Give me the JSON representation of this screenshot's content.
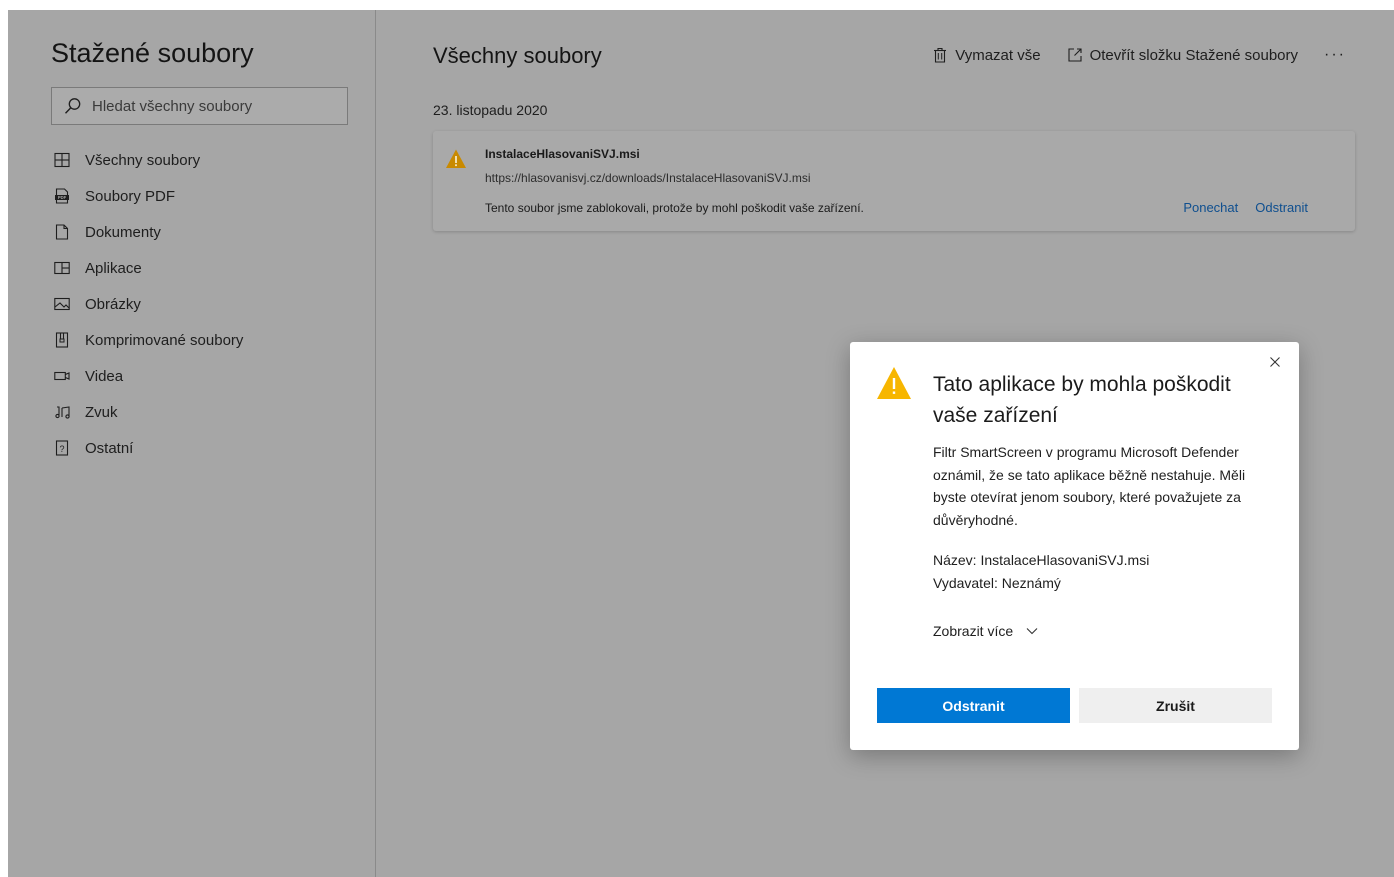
{
  "sidebar": {
    "title": "Stažené soubory",
    "search_placeholder": "Hledat všechny soubory",
    "items": [
      {
        "label": "Všechny soubory",
        "icon": "grid-icon"
      },
      {
        "label": "Soubory PDF",
        "icon": "pdf-icon"
      },
      {
        "label": "Dokumenty",
        "icon": "document-icon"
      },
      {
        "label": "Aplikace",
        "icon": "application-icon"
      },
      {
        "label": "Obrázky",
        "icon": "image-icon"
      },
      {
        "label": "Komprimované soubory",
        "icon": "zip-icon"
      },
      {
        "label": "Videa",
        "icon": "video-icon"
      },
      {
        "label": "Zvuk",
        "icon": "music-icon"
      },
      {
        "label": "Ostatní",
        "icon": "unknown-file-icon"
      }
    ]
  },
  "main": {
    "title": "Všechny soubory",
    "toolbar": {
      "clear_all": "Vymazat vše",
      "open_folder": "Otevřít složku Stažené soubory",
      "more": "···"
    },
    "date_heading": "23. listopadu 2020",
    "download": {
      "filename": "InstalaceHlasovaniSVJ.msi",
      "url": "https://hlasovanisvj.cz/downloads/InstalaceHlasovaniSVJ.msi",
      "status": "Tento soubor jsme zablokovali, protože by mohl poškodit vaše zařízení.",
      "keep_label": "Ponechat",
      "delete_label": "Odstranit"
    }
  },
  "dialog": {
    "title": "Tato aplikace by mohla poškodit vaše zařízení",
    "body": "Filtr SmartScreen v programu Microsoft Defender oznámil, že se tato aplikace běžně nestahuje. Měli byste otevírat jenom soubory, které považujete za důvěryhodné.",
    "name_line": "Název: InstalaceHlasovaniSVJ.msi",
    "publisher_line": "Vydavatel: Neznámý",
    "show_more": "Zobrazit více",
    "primary_button": "Odstranit",
    "secondary_button": "Zrušit"
  },
  "colors": {
    "accent": "#0078d4",
    "warning": "#f0b400",
    "link": "#0f4f8f",
    "overlay": "#a6a6a6"
  }
}
